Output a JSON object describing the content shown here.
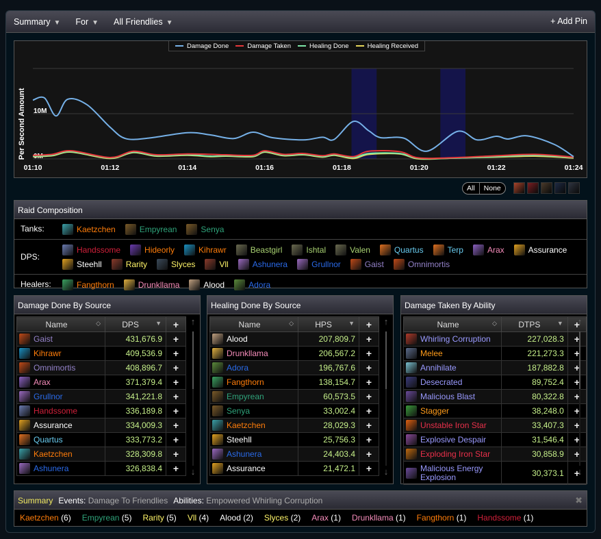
{
  "topbar": {
    "summary": "Summary",
    "for": "For",
    "friendlies": "All Friendlies",
    "add_pin": "+ Add Pin",
    "caret": "▼"
  },
  "chart_data": {
    "type": "line",
    "ylabel": "Per Second Amount",
    "y_ticks": [
      {
        "v": 0,
        "label": "0M"
      },
      {
        "v": 10,
        "label": "10M"
      },
      {
        "v": 20,
        "label": ""
      }
    ],
    "ylim": [
      0,
      20
    ],
    "x_ticks": [
      "01:10",
      "01:12",
      "01:14",
      "01:16",
      "01:18",
      "01:20",
      "01:22",
      "01:24"
    ],
    "xlim": [
      "01:10",
      "01:24"
    ],
    "grid": true,
    "legend_position": "top-center",
    "highlight_ranges": [
      [
        "01:18.25",
        "01:18.9"
      ],
      [
        "01:20.55",
        "01:21.2"
      ]
    ],
    "highlight_color": "#14144a",
    "series": [
      {
        "name": "Damage Done",
        "color": "#76b1e8",
        "points": [
          [
            "01:10.0",
            13
          ],
          [
            "01:10.3",
            13.5
          ],
          [
            "01:10.6",
            9.5
          ],
          [
            "01:10.9",
            13.2
          ],
          [
            "01:11.4",
            12
          ],
          [
            "01:12.0",
            7
          ],
          [
            "01:12.4",
            4.5
          ],
          [
            "01:13.0",
            4.6
          ],
          [
            "01:14.0",
            5.8
          ],
          [
            "01:14.6",
            5.3
          ],
          [
            "01:15.2",
            4.5
          ],
          [
            "01:15.7",
            5.9
          ],
          [
            "01:16.2",
            4.7
          ],
          [
            "01:17.0",
            4.2
          ],
          [
            "01:17.5",
            4.8
          ],
          [
            "01:17.8",
            4.3
          ],
          [
            "01:18.3",
            8.3
          ],
          [
            "01:18.7",
            6.2
          ],
          [
            "01:19.0",
            4.7
          ],
          [
            "01:19.6",
            4.6
          ],
          [
            "01:20.2",
            1.7
          ],
          [
            "01:21.0",
            6.1
          ],
          [
            "01:21.5",
            4.2
          ],
          [
            "01:22.0",
            5.0
          ],
          [
            "01:22.3",
            4.4
          ],
          [
            "01:22.8",
            5.1
          ],
          [
            "01:23.5",
            3.2
          ],
          [
            "01:24.0",
            0.5
          ]
        ]
      },
      {
        "name": "Damage Taken",
        "color": "#e8383a",
        "points": [
          [
            "01:10.0",
            0.8
          ],
          [
            "01:10.5",
            1.0
          ],
          [
            "01:11.0",
            1.8
          ],
          [
            "01:12.0",
            0.3
          ],
          [
            "01:12.6",
            1.7
          ],
          [
            "01:13.2",
            0.9
          ],
          [
            "01:14.0",
            1.1
          ],
          [
            "01:14.6",
            1.0
          ],
          [
            "01:15.0",
            0.9
          ],
          [
            "01:15.7",
            0.8
          ],
          [
            "01:16.0",
            1.8
          ],
          [
            "01:16.5",
            1.0
          ],
          [
            "01:17.0",
            1.2
          ],
          [
            "01:17.5",
            0.7
          ],
          [
            "01:17.8",
            1.1
          ],
          [
            "01:18.3",
            0.5
          ],
          [
            "01:18.7",
            1.7
          ],
          [
            "01:19.5",
            1.6
          ],
          [
            "01:20.0",
            0.2
          ],
          [
            "01:21.0",
            0.3
          ],
          [
            "01:22.0",
            0.7
          ],
          [
            "01:23.0",
            1.0
          ],
          [
            "01:24.0",
            0.4
          ]
        ]
      },
      {
        "name": "Healing Done",
        "color": "#7ee8a8",
        "points": [
          [
            "01:10.0",
            0.6
          ],
          [
            "01:10.5",
            0.8
          ],
          [
            "01:11.0",
            1.6
          ],
          [
            "01:12.0",
            0.2
          ],
          [
            "01:12.6",
            1.5
          ],
          [
            "01:13.2",
            0.7
          ],
          [
            "01:14.0",
            0.9
          ],
          [
            "01:14.6",
            0.6
          ],
          [
            "01:15.0",
            0.7
          ],
          [
            "01:15.7",
            0.6
          ],
          [
            "01:16.0",
            1.6
          ],
          [
            "01:16.5",
            0.8
          ],
          [
            "01:17.0",
            1.0
          ],
          [
            "01:17.5",
            0.5
          ],
          [
            "01:17.8",
            0.9
          ],
          [
            "01:18.3",
            0.3
          ],
          [
            "01:18.7",
            1.2
          ],
          [
            "01:19.5",
            1.2
          ],
          [
            "01:20.0",
            0.1
          ],
          [
            "01:21.0",
            0.2
          ],
          [
            "01:22.0",
            0.5
          ],
          [
            "01:23.0",
            0.8
          ],
          [
            "01:24.0",
            0.3
          ]
        ]
      },
      {
        "name": "Healing Received",
        "color": "#e6d65a",
        "points": [
          [
            "01:10.0",
            0.5
          ],
          [
            "01:10.5",
            0.7
          ],
          [
            "01:11.0",
            1.5
          ],
          [
            "01:12.0",
            0.1
          ],
          [
            "01:12.6",
            1.4
          ],
          [
            "01:13.2",
            0.6
          ],
          [
            "01:14.0",
            0.8
          ],
          [
            "01:14.6",
            0.5
          ],
          [
            "01:15.0",
            0.6
          ],
          [
            "01:15.7",
            0.5
          ],
          [
            "01:16.0",
            1.5
          ],
          [
            "01:16.5",
            0.7
          ],
          [
            "01:17.0",
            0.9
          ],
          [
            "01:17.5",
            0.4
          ],
          [
            "01:17.8",
            0.8
          ],
          [
            "01:18.3",
            0.1
          ],
          [
            "01:18.7",
            1.0
          ],
          [
            "01:19.5",
            1.1
          ],
          [
            "01:20.0",
            0.0
          ],
          [
            "01:21.0",
            0.2
          ],
          [
            "01:22.0",
            0.4
          ],
          [
            "01:23.0",
            0.6
          ],
          [
            "01:24.0",
            0.2
          ]
        ]
      }
    ]
  },
  "timeline": {
    "all": "All",
    "none": "None",
    "icons": [
      {
        "name": "fire-boss-icon",
        "color": "#a8442a"
      },
      {
        "name": "flame-rune-icon",
        "color": "#7a1e22"
      },
      {
        "name": "warrior-boss-icon",
        "color": "#4a3a2a"
      },
      {
        "name": "demon-boss-icon",
        "color": "#1e2a44"
      },
      {
        "name": "skull-boss-icon",
        "color": "#2e3440"
      }
    ]
  },
  "raid": {
    "title": "Raid Composition",
    "rows": [
      {
        "label": "Tanks:",
        "members": [
          {
            "name": "Kaetzchen",
            "color": "#ff7d0a",
            "icon": "#3aa0a8"
          },
          {
            "name": "Empyrean",
            "color": "#2fa37a",
            "icon": "#7a5a28"
          },
          {
            "name": "Senya",
            "color": "#2fa37a",
            "icon": "#7a5a28"
          }
        ]
      },
      {
        "label": "DPS:",
        "members": [
          {
            "name": "Handssome",
            "color": "#d0203a",
            "icon": "#6a7ab0"
          },
          {
            "name": "Hideorly",
            "color": "#ff7d0a",
            "icon": "#6a3ab0"
          },
          {
            "name": "Kihrawr",
            "color": "#ff7d0a",
            "icon": "#1a90c0"
          },
          {
            "name": "Beastgirl",
            "color": "#abd473",
            "icon": "#6a6a50"
          },
          {
            "name": "Ishtal",
            "color": "#abd473",
            "icon": "#6a6a50"
          },
          {
            "name": "Valen",
            "color": "#abd473",
            "icon": "#6a6a50"
          },
          {
            "name": "Quartus",
            "color": "#69ccf0",
            "icon": "#e07020"
          },
          {
            "name": "Terp",
            "color": "#69ccf0",
            "icon": "#e07020"
          },
          {
            "name": "Arax",
            "color": "#f58cba",
            "icon": "#8a60c0"
          },
          {
            "name": "Assurance",
            "color": "#ffffff",
            "icon": "#e0a020"
          },
          {
            "name": "Steehll",
            "color": "#ffffff",
            "icon": "#e0a020"
          },
          {
            "name": "Rarity",
            "color": "#fff569",
            "icon": "#8a3a2a"
          },
          {
            "name": "Slyces",
            "color": "#fff569",
            "icon": "#3a4a5a"
          },
          {
            "name": "Vll",
            "color": "#fff569",
            "icon": "#8a3a2a"
          },
          {
            "name": "Ashunera",
            "color": "#2a6ae8",
            "icon": "#9a6ac0"
          },
          {
            "name": "Grullnor",
            "color": "#2a6ae8",
            "icon": "#9a6ac0"
          },
          {
            "name": "Gaist",
            "color": "#9482c9",
            "icon": "#c04a18"
          },
          {
            "name": "Omnimortis",
            "color": "#9482c9",
            "icon": "#c04a18"
          }
        ]
      },
      {
        "label": "Healers:",
        "members": [
          {
            "name": "Fangthorn",
            "color": "#ff7d0a",
            "icon": "#3aa060"
          },
          {
            "name": "Drunkllama",
            "color": "#f58cba",
            "icon": "#e0b040"
          },
          {
            "name": "Alood",
            "color": "#ffffff",
            "icon": "#c0a080"
          },
          {
            "name": "Adora",
            "color": "#2a6ae8",
            "icon": "#5a8a3a"
          }
        ]
      }
    ]
  },
  "tables": [
    {
      "title": "Damage Done By Source",
      "col_name": "Name",
      "col_value": "DPS",
      "plus": "+",
      "rows": [
        {
          "name": "Gaist",
          "value": "431,676.9",
          "color": "#9482c9",
          "icon": "#c04a18"
        },
        {
          "name": "Kihrawr",
          "value": "409,536.9",
          "color": "#ff7d0a",
          "icon": "#1a90c0"
        },
        {
          "name": "Omnimortis",
          "value": "408,896.7",
          "color": "#9482c9",
          "icon": "#c04a18"
        },
        {
          "name": "Arax",
          "value": "371,379.4",
          "color": "#f58cba",
          "icon": "#8a60c0"
        },
        {
          "name": "Grullnor",
          "value": "341,221.8",
          "color": "#2a6ae8",
          "icon": "#9a6ac0"
        },
        {
          "name": "Handssome",
          "value": "336,189.8",
          "color": "#d0203a",
          "icon": "#6a7ab0"
        },
        {
          "name": "Assurance",
          "value": "334,009.3",
          "color": "#ffffff",
          "icon": "#e0a020"
        },
        {
          "name": "Quartus",
          "value": "333,773.2",
          "color": "#69ccf0",
          "icon": "#e07020"
        },
        {
          "name": "Kaetzchen",
          "value": "328,309.8",
          "color": "#ff7d0a",
          "icon": "#3aa0a8"
        },
        {
          "name": "Ashunera",
          "value": "326,838.4",
          "color": "#2a6ae8",
          "icon": "#9a6ac0"
        }
      ]
    },
    {
      "title": "Healing Done By Source",
      "col_name": "Name",
      "col_value": "HPS",
      "plus": "+",
      "rows": [
        {
          "name": "Alood",
          "value": "207,809.7",
          "color": "#ffffff",
          "icon": "#c0a080"
        },
        {
          "name": "Drunkllama",
          "value": "206,567.2",
          "color": "#f58cba",
          "icon": "#e0b040"
        },
        {
          "name": "Adora",
          "value": "196,767.6",
          "color": "#2a6ae8",
          "icon": "#5a8a3a"
        },
        {
          "name": "Fangthorn",
          "value": "138,154.7",
          "color": "#ff7d0a",
          "icon": "#3aa060"
        },
        {
          "name": "Empyrean",
          "value": "60,573.5",
          "color": "#2fa37a",
          "icon": "#7a5a28"
        },
        {
          "name": "Senya",
          "value": "33,002.4",
          "color": "#2fa37a",
          "icon": "#7a5a28"
        },
        {
          "name": "Kaetzchen",
          "value": "28,029.3",
          "color": "#ff7d0a",
          "icon": "#3aa0a8"
        },
        {
          "name": "Steehll",
          "value": "25,756.3",
          "color": "#ffffff",
          "icon": "#e0a020"
        },
        {
          "name": "Ashunera",
          "value": "24,403.4",
          "color": "#2a6ae8",
          "icon": "#9a6ac0"
        },
        {
          "name": "Assurance",
          "value": "21,472.1",
          "color": "#ffffff",
          "icon": "#e0a020"
        }
      ]
    },
    {
      "title": "Damage Taken By Ability",
      "col_name": "Name",
      "col_value": "DTPS",
      "plus": "+",
      "rows": [
        {
          "name": "Whirling Corruption",
          "value": "227,028.3",
          "color": "#9a9aff",
          "icon": "#b03a2a"
        },
        {
          "name": "Melee",
          "value": "221,273.3",
          "color": "#ff9c1a",
          "icon": "#5a6a8a"
        },
        {
          "name": "Annihilate",
          "value": "187,882.8",
          "color": "#9a9aff",
          "icon": "#7ac0d0"
        },
        {
          "name": "Desecrated",
          "value": "89,752.4",
          "color": "#9a9aff",
          "icon": "#3a3a7a"
        },
        {
          "name": "Malicious Blast",
          "value": "80,322.8",
          "color": "#9a9aff",
          "icon": "#6a4a9a"
        },
        {
          "name": "Stagger",
          "value": "38,248.0",
          "color": "#ff9c1a",
          "icon": "#3a9a3a"
        },
        {
          "name": "Unstable Iron Star",
          "value": "33,407.3",
          "color": "#e8304a",
          "icon": "#e06010"
        },
        {
          "name": "Explosive Despair",
          "value": "31,546.4",
          "color": "#9a9aff",
          "icon": "#8a4a9a"
        },
        {
          "name": "Exploding Iron Star",
          "value": "30,858.9",
          "color": "#e8304a",
          "icon": "#c06a10"
        },
        {
          "name": "Malicious Energy Explosion",
          "value": "30,373.1",
          "color": "#9a9aff",
          "icon": "#6a4a9a"
        }
      ]
    }
  ],
  "summary": {
    "title": "Summary",
    "events_label": "Events:",
    "events_value": "Damage To Friendlies",
    "abilities_label": "Abilities:",
    "abilities_value": "Empowered Whirling Corruption",
    "close": "✖",
    "items": [
      {
        "name": "Kaetzchen",
        "count": "(6)",
        "color": "#ff7d0a"
      },
      {
        "name": "Empyrean",
        "count": "(5)",
        "color": "#2fa37a"
      },
      {
        "name": "Rarity",
        "count": "(5)",
        "color": "#fff569"
      },
      {
        "name": "Vll",
        "count": "(4)",
        "color": "#fff569"
      },
      {
        "name": "Alood",
        "count": "(2)",
        "color": "#ffffff"
      },
      {
        "name": "Slyces",
        "count": "(2)",
        "color": "#fff569"
      },
      {
        "name": "Arax",
        "count": "(1)",
        "color": "#f58cba"
      },
      {
        "name": "Drunkllama",
        "count": "(1)",
        "color": "#f58cba"
      },
      {
        "name": "Fangthorn",
        "count": "(1)",
        "color": "#ff7d0a"
      },
      {
        "name": "Handssome",
        "count": "(1)",
        "color": "#d0203a"
      }
    ]
  }
}
